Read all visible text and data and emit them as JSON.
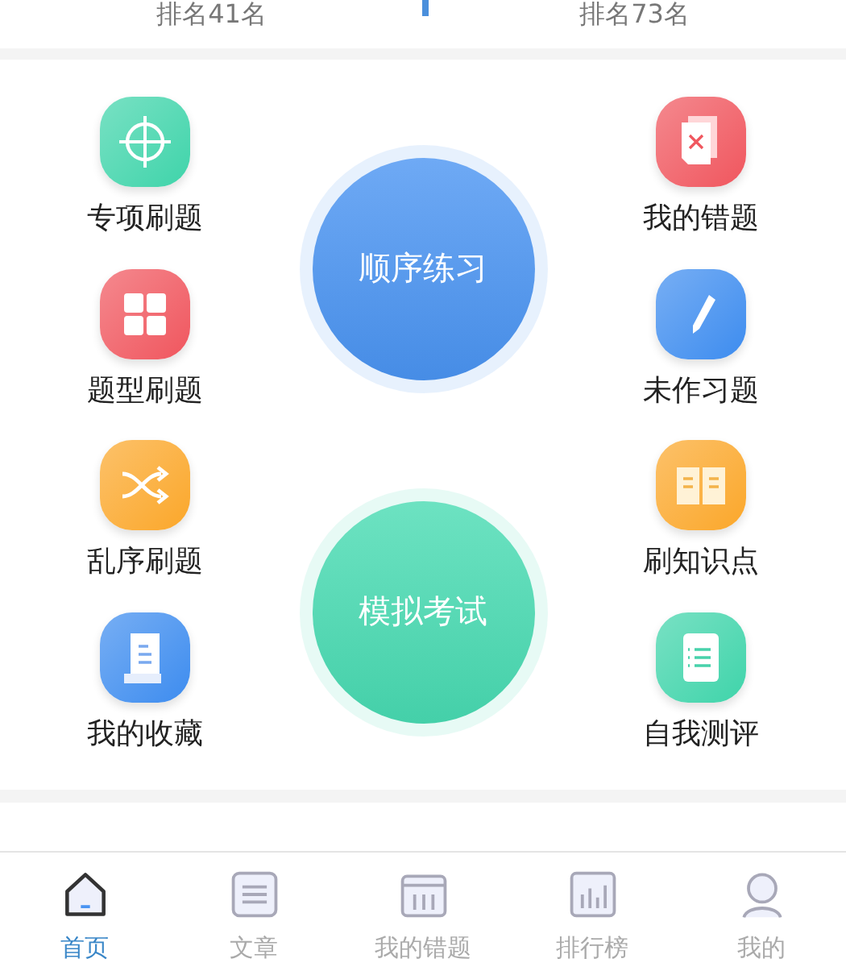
{
  "ranks": [
    "排名41名",
    "排名73名"
  ],
  "left_items": [
    {
      "label": "专项刷题",
      "color": "#3fd4aa"
    },
    {
      "label": "题型刷题",
      "color": "#f0565e"
    },
    {
      "label": "乱序刷题",
      "color": "#fba72a"
    },
    {
      "label": "我的收藏",
      "color": "#3d8cef"
    }
  ],
  "right_items": [
    {
      "label": "我的错题",
      "color": "#f0565e"
    },
    {
      "label": "未作习题",
      "color": "#3d8cef"
    },
    {
      "label": "刷知识点",
      "color": "#fba72a"
    },
    {
      "label": "自我测评",
      "color": "#3fd4aa"
    }
  ],
  "main_buttons": [
    {
      "label": "顺序练习",
      "color": "#4a94f2"
    },
    {
      "label": "模拟考试",
      "color": "#48dbb2"
    }
  ],
  "tabs": [
    {
      "label": "首页",
      "selected": true
    },
    {
      "label": "文章",
      "selected": false
    },
    {
      "label": "我的错题",
      "selected": false
    },
    {
      "label": "排行榜",
      "selected": false
    },
    {
      "label": "我的",
      "selected": false
    }
  ]
}
